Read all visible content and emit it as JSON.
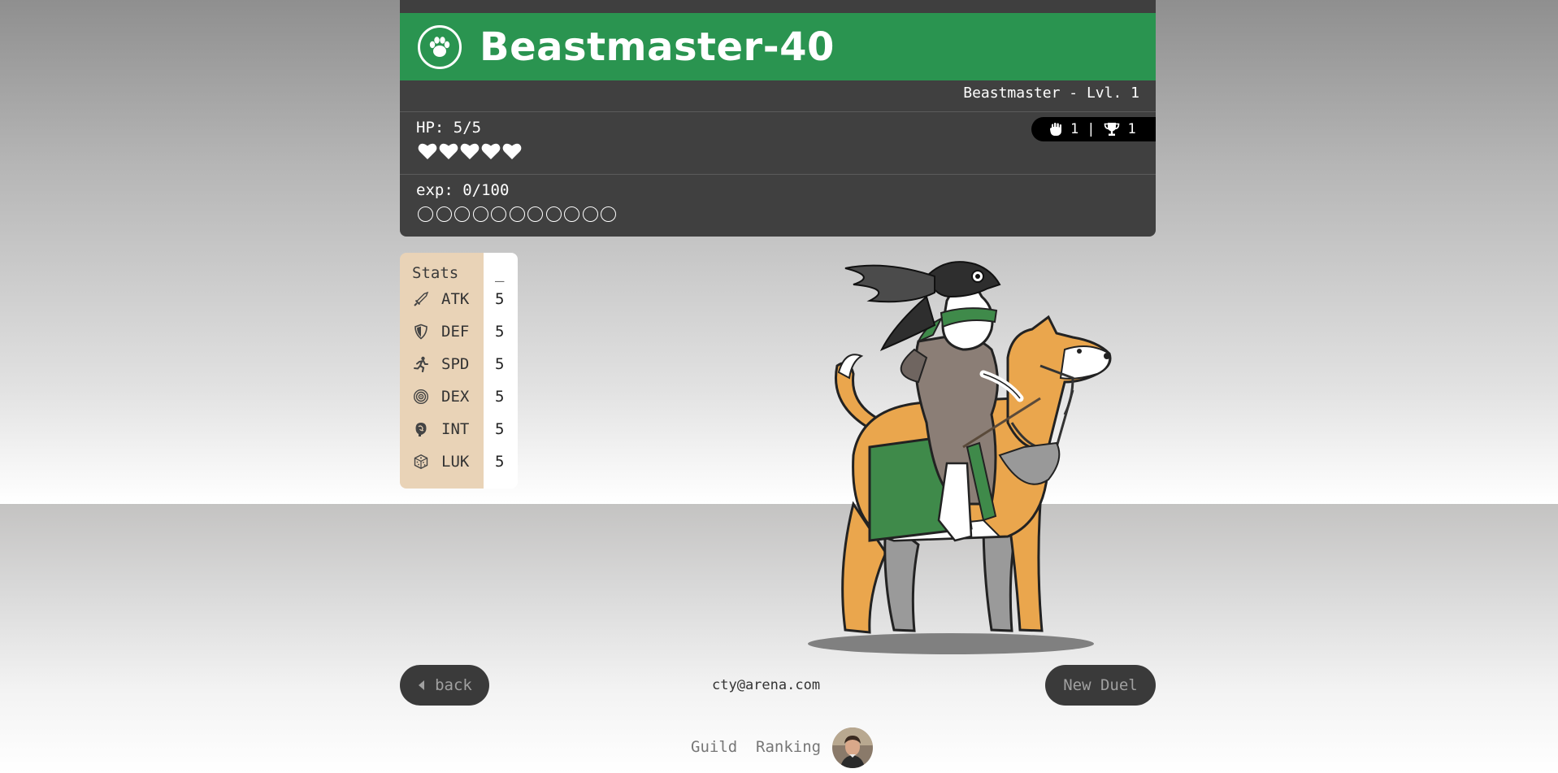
{
  "header": {
    "title": "Beastmaster-40",
    "class_level": "Beastmaster - Lvl. 1",
    "hp_label": "HP: 5/5",
    "hp": {
      "current": 5,
      "max": 5
    },
    "exp_label": "exp: 0/100",
    "exp": {
      "current": 0,
      "max": 100,
      "dots": 11
    },
    "duels_count": "1",
    "separator": "|",
    "wins_count": "1"
  },
  "stats": {
    "heading": "Stats",
    "toggle": "_",
    "items": [
      {
        "label": "ATK",
        "value": "5",
        "icon": "sword-icon"
      },
      {
        "label": "DEF",
        "value": "5",
        "icon": "shield-icon"
      },
      {
        "label": "SPD",
        "value": "5",
        "icon": "running-icon"
      },
      {
        "label": "DEX",
        "value": "5",
        "icon": "target-icon"
      },
      {
        "label": "INT",
        "value": "5",
        "icon": "brain-icon"
      },
      {
        "label": "LUK",
        "value": "5",
        "icon": "dice-icon"
      }
    ]
  },
  "nav": {
    "back_label": "back",
    "new_duel_label": "New Duel",
    "email": "cty@arena.com",
    "guild_label": "Guild",
    "ranking_label": "Ranking"
  },
  "colors": {
    "banner": "#2a9450",
    "card": "#404040",
    "stats_panel": "#e9d3b7",
    "button": "#3a3a3a"
  }
}
